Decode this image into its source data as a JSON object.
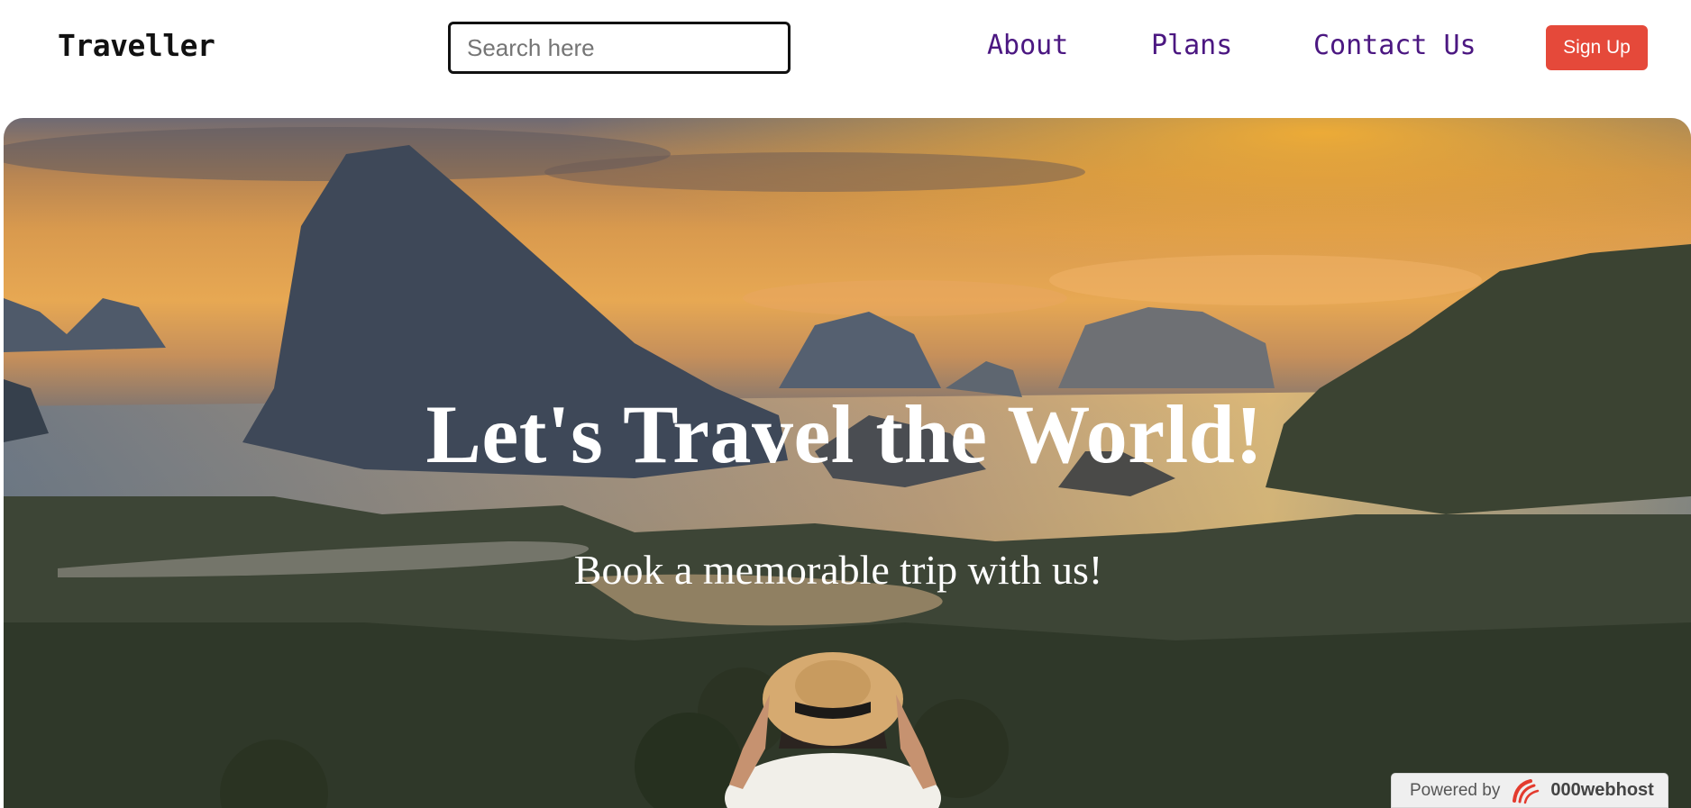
{
  "header": {
    "brand": "Traveller",
    "search": {
      "placeholder": "Search here",
      "value": ""
    },
    "nav": [
      {
        "label": "About"
      },
      {
        "label": "Plans"
      },
      {
        "label": "Contact Us"
      }
    ],
    "signup_label": "Sign Up"
  },
  "hero": {
    "title": "Let's Travel the World!",
    "subtitle": "Book a memorable trip with us!",
    "image": "sunset-bay-with-traveller-in-hat"
  },
  "badge": {
    "powered_by": "Powered by",
    "host": "000webhost",
    "icon": "webhost-logo-icon"
  },
  "colors": {
    "nav_link": "#4b1781",
    "signup_bg": "#e5493a",
    "brand_text": "#111111"
  }
}
